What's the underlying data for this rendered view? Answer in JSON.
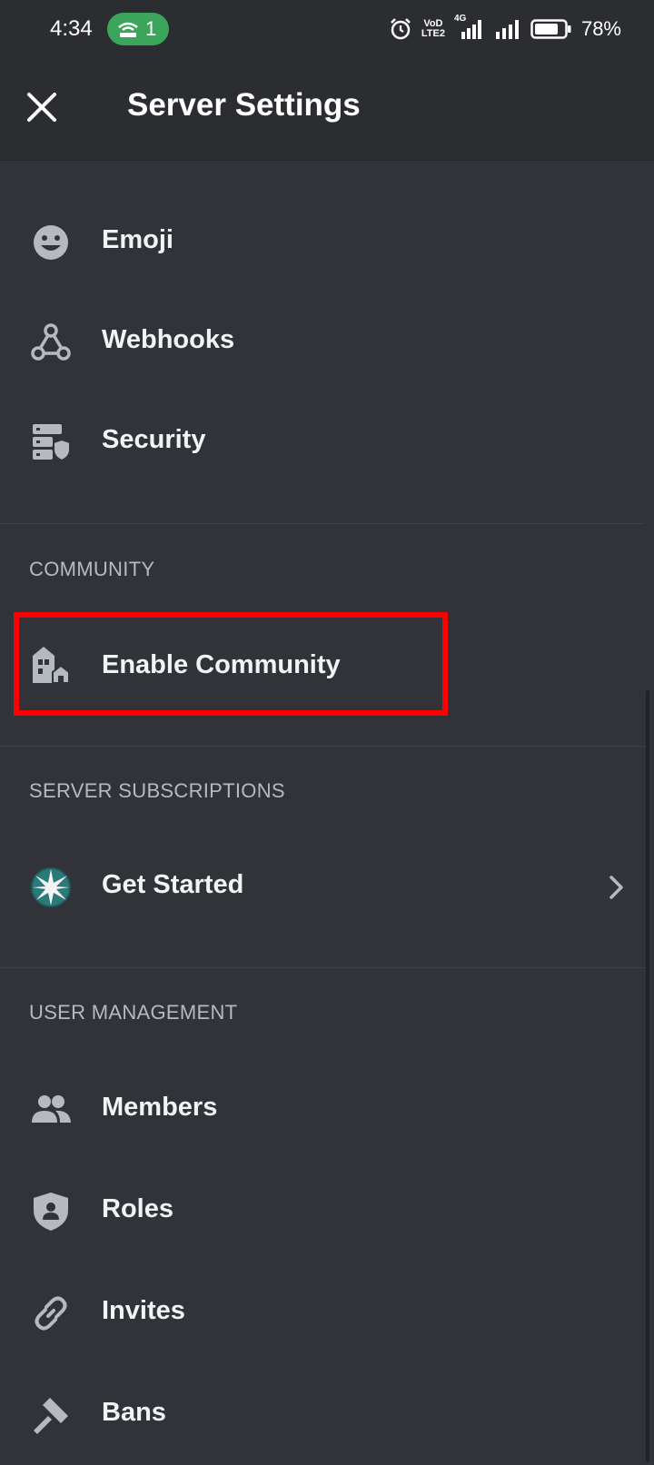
{
  "status_bar": {
    "time": "4:34",
    "hotspot_count": "1",
    "network_top": "VoD",
    "network_bottom": "LTE2",
    "signal_label": "4G",
    "battery_percent": "78%",
    "battery_level": 0.78
  },
  "header": {
    "title": "Server Settings"
  },
  "items": {
    "emoji": "Emoji",
    "webhooks": "Webhooks",
    "security": "Security"
  },
  "community": {
    "header": "COMMUNITY",
    "enable_label": "Enable Community"
  },
  "subscriptions": {
    "header": "SERVER SUBSCRIPTIONS",
    "get_started_label": "Get Started"
  },
  "user_management": {
    "header": "USER MANAGEMENT",
    "members": "Members",
    "roles": "Roles",
    "invites": "Invites",
    "bans": "Bans"
  },
  "colors": {
    "background": "#313338",
    "header_bg": "#2b2d31",
    "text": "#f2f3f5",
    "section_text": "#b5bac1",
    "icon": "#b5bac1",
    "highlight": "#ff0000",
    "hotspot": "#3ba55c"
  }
}
